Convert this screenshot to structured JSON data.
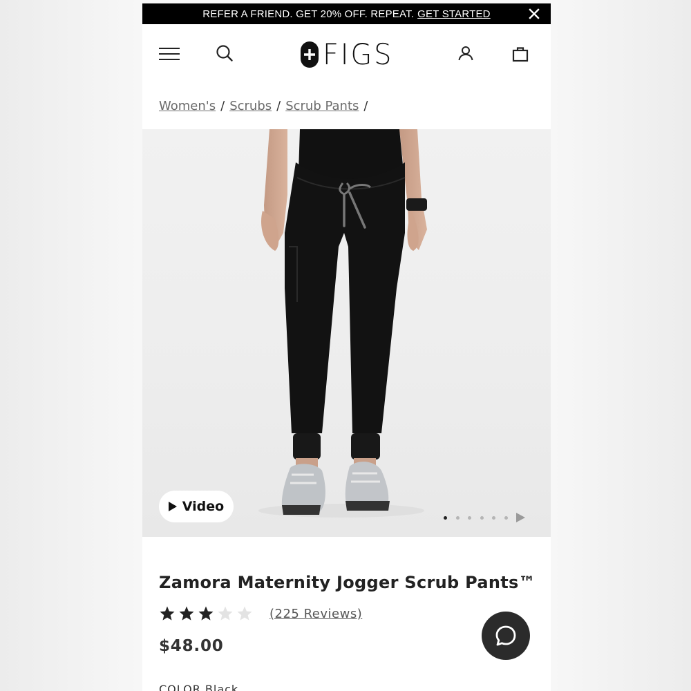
{
  "promo": {
    "text": "REFER A FRIEND. GET 20% OFF. REPEAT.",
    "link": "GET STARTED"
  },
  "header": {
    "logo_text": "FIGS",
    "icons": [
      "menu-icon",
      "search-icon",
      "account-icon",
      "bag-icon"
    ]
  },
  "breadcrumb": {
    "items": [
      "Women's",
      "Scrubs",
      "Scrub Pants"
    ],
    "separator": "/"
  },
  "gallery": {
    "video_label": "Video",
    "slide_count": 6,
    "active_slide": 1
  },
  "product": {
    "title": "Zamora Maternity Jogger Scrub Pants™",
    "rating": 3,
    "rating_max": 5,
    "reviews_label": "(225 Reviews)",
    "price": "$48.00",
    "color_label": "COLOR Black"
  },
  "colors": {
    "promo_bg": "#000000",
    "star_filled": "#222222",
    "star_empty": "#e0e0e0",
    "chat_bg": "#2b2b2b"
  }
}
